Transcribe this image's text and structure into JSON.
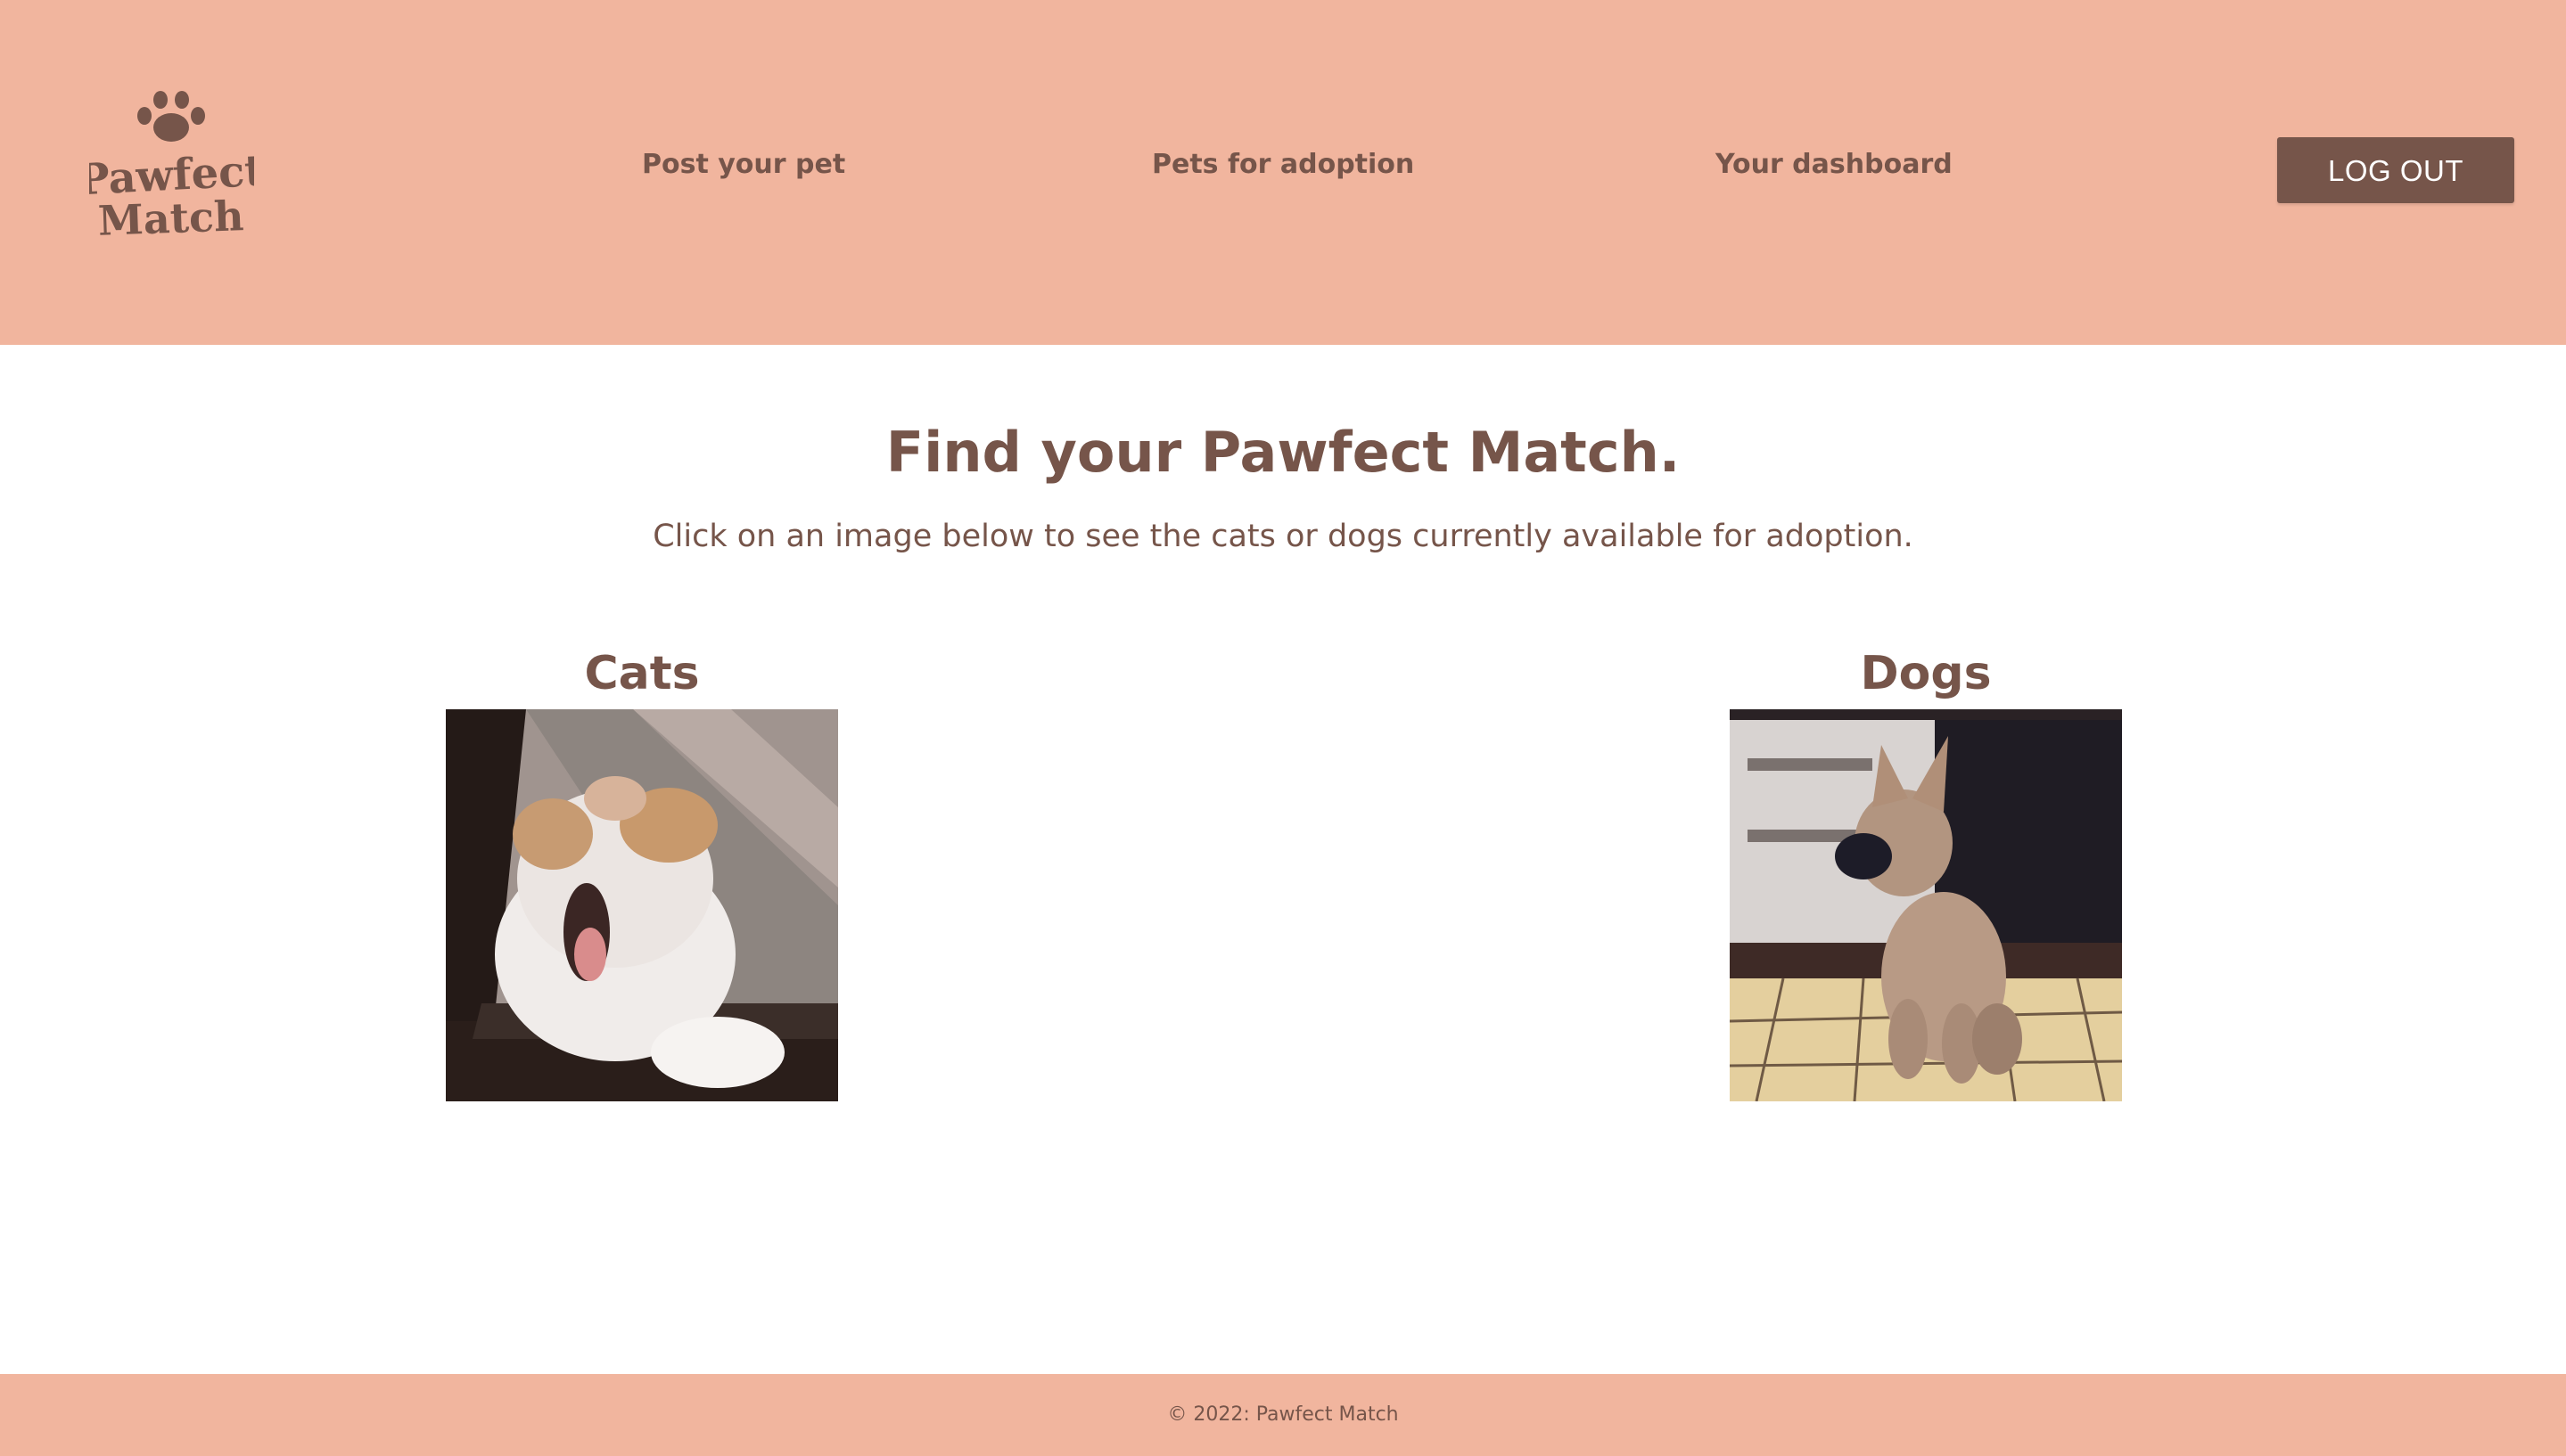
{
  "brand": {
    "name_line1": "Pawfect",
    "name_line2": "Match",
    "icon": "paw-icon"
  },
  "nav": {
    "post_pet": "Post your pet",
    "pets_for_adoption": "Pets for adoption",
    "dashboard": "Your dashboard"
  },
  "logout_label": "LOG OUT",
  "main": {
    "title": "Find your Pawfect Match.",
    "subtitle": "Click on an image below to see the cats or dogs currently available for adoption."
  },
  "categories": [
    {
      "label": "Cats",
      "image": "yawning-cat-photo"
    },
    {
      "label": "Dogs",
      "image": "puppy-photo"
    }
  ],
  "footer": {
    "copyright": "© 2022: Pawfect Match"
  },
  "colors": {
    "header_bg": "#f1b59e",
    "brand_brown": "#76554a",
    "page_bg": "#ffffff"
  }
}
